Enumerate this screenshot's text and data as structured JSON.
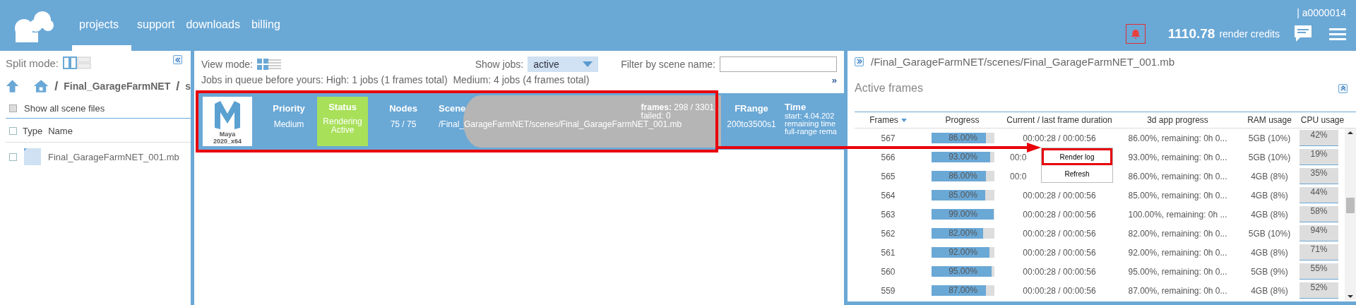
{
  "header": {
    "nav": [
      {
        "label": "projects",
        "selected": true
      },
      {
        "label": "support",
        "selected": false
      },
      {
        "label": "downloads",
        "selected": false
      },
      {
        "label": "billing",
        "selected": false
      }
    ],
    "user": "| a0000014",
    "credits_value": "1110.78",
    "credits_label": "render credits"
  },
  "file_panel": {
    "split_label": "Split mode:",
    "separator": "/",
    "breadcrumb": [
      "Final_GarageFarmNET",
      "s"
    ],
    "show_all": {
      "label": "Show all scene files",
      "checked": false
    },
    "select_all_checked": false,
    "columns": [
      "Type",
      "Name"
    ],
    "files": [
      {
        "name": "Final_GarageFarmNET_001.mb",
        "checked": false
      }
    ]
  },
  "jobs_panel": {
    "view_mode_label": "View mode:",
    "show_jobs_label": "Show jobs:",
    "show_jobs_value": "active",
    "filter_label": "Filter by scene name:",
    "queue_text": "Jobs in queue before yours: High: 1 jobs (1 frames total)  Medium: 4 jobs (4 frames total)",
    "expand": "»",
    "job": {
      "app": "Maya",
      "version": "2020_x64",
      "priority_label": "Priority",
      "priority": "Medium",
      "status_label": "Status",
      "status": "Rendering Active",
      "nodes_label": "Nodes",
      "nodes": "75 / 75",
      "scene_label": "Scene",
      "scene": "/Final_GarageFarmNET/scenes/Final_GarageFarmNET_001.mb",
      "frames_label": "frames:",
      "frames": "298 / 3301",
      "failed": "failed: 0",
      "frange_label": "FRange",
      "frange": "200to3500s1",
      "time_label": "Time",
      "time_lines": [
        "start: 4.04.202",
        "remaining time",
        "full-range rema"
      ]
    }
  },
  "frames_panel": {
    "path": "/Final_GarageFarmNET/scenes/Final_GarageFarmNET_001.mb",
    "title": "Active frames",
    "columns": [
      "Frames",
      "Progress",
      "Current / last frame duration",
      "3d app progress",
      "RAM usage",
      "CPU usage"
    ],
    "rows": [
      {
        "frame": "567",
        "progress": "86.00%",
        "level": 0.86,
        "duration": "00:00:28 / 00:00:56",
        "app_progress": "86.00%, remaining: 0h 0...",
        "ram": "5GB (10%)",
        "cpu": "42%"
      },
      {
        "frame": "566",
        "progress": "93.00%",
        "level": 0.93,
        "duration": "00:0",
        "app_progress": "93.00%, remaining: 0h 0...",
        "ram": "5GB (10%)",
        "cpu": "19%"
      },
      {
        "frame": "565",
        "progress": "86.00%",
        "level": 0.86,
        "duration": "00:0",
        "app_progress": "86.00%, remaining: 0h 0...",
        "ram": "4GB (8%)",
        "cpu": "35%"
      },
      {
        "frame": "564",
        "progress": "85.00%",
        "level": 0.85,
        "duration": "00:00:28 / 00:00:56",
        "app_progress": "85.00%, remaining: 0h 0...",
        "ram": "4GB (8%)",
        "cpu": "44%"
      },
      {
        "frame": "563",
        "progress": "99.00%",
        "level": 0.99,
        "duration": "00:00:28 / 00:00:56",
        "app_progress": "100.00%, remaining: 0h ...",
        "ram": "4GB (8%)",
        "cpu": "58%"
      },
      {
        "frame": "562",
        "progress": "82.00%",
        "level": 0.82,
        "duration": "00:00:28 / 00:00:56",
        "app_progress": "82.00%, remaining: 0h 0...",
        "ram": "5GB (10%)",
        "cpu": "94%"
      },
      {
        "frame": "561",
        "progress": "92.00%",
        "level": 0.92,
        "duration": "00:00:28 / 00:00:56",
        "app_progress": "92.00%, remaining: 0h 0...",
        "ram": "4GB (8%)",
        "cpu": "71%"
      },
      {
        "frame": "560",
        "progress": "95.00%",
        "level": 0.95,
        "duration": "00:00:28 / 00:00:56",
        "app_progress": "95.00%, remaining: 0h 0...",
        "ram": "5GB (9%)",
        "cpu": "55%"
      },
      {
        "frame": "559",
        "progress": "87.00%",
        "level": 0.87,
        "duration": "00:00:28 / 00:00:56",
        "app_progress": "87.00%, remaining: 0h 0...",
        "ram": "4GB (8%)",
        "cpu": "52%"
      }
    ],
    "context_menu": [
      {
        "label": "Render log",
        "highlighted": true
      },
      {
        "label": "Refresh",
        "highlighted": false
      }
    ]
  }
}
